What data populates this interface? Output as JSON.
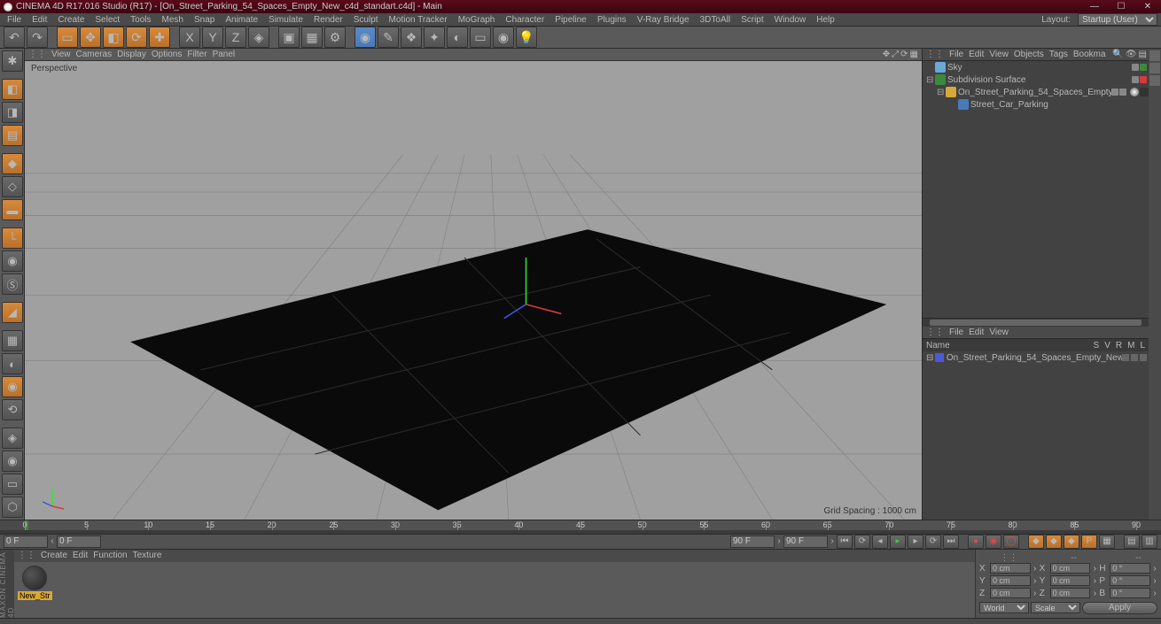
{
  "titlebar": {
    "title": "CINEMA 4D R17.016 Studio (R17) - [On_Street_Parking_54_Spaces_Empty_New_c4d_standart.c4d] - Main"
  },
  "menubar": {
    "items": [
      "File",
      "Edit",
      "Create",
      "Select",
      "Tools",
      "Mesh",
      "Snap",
      "Animate",
      "Simulate",
      "Render",
      "Sculpt",
      "Motion Tracker",
      "MoGraph",
      "Character",
      "Pipeline",
      "Plugins",
      "V-Ray Bridge",
      "3DToAll",
      "Script",
      "Window",
      "Help"
    ],
    "layout_label": "Layout:",
    "layout_value": "Startup (User)"
  },
  "viewport_menubar": {
    "items": [
      "View",
      "Cameras",
      "Display",
      "Options",
      "Filter",
      "Panel"
    ]
  },
  "viewport": {
    "label": "Perspective",
    "grid_spacing": "Grid Spacing : 1000 cm"
  },
  "objects_panel": {
    "menu": [
      "File",
      "Edit",
      "View",
      "Objects",
      "Tags",
      "Bookma"
    ],
    "tree": [
      {
        "depth": 0,
        "icon": "#6aa8d8",
        "label": "Sky",
        "dots": [
          "#888",
          "#3a8a3a"
        ]
      },
      {
        "depth": 0,
        "icon": "#3a8a3a",
        "label": "Subdivision Surface",
        "dots": [
          "#888",
          "#d83a3a"
        ],
        "exp": "⊟"
      },
      {
        "depth": 1,
        "icon": "#d8a838",
        "label": "On_Street_Parking_54_Spaces_Empty_New",
        "dots": [
          "#888",
          "#888"
        ],
        "tags": true,
        "exp": "⊟"
      },
      {
        "depth": 2,
        "icon": "#4a7ab8",
        "label": "Street_Car_Parking",
        "dots": []
      }
    ]
  },
  "takes_panel": {
    "menu": [
      "File",
      "Edit",
      "View"
    ],
    "header": {
      "name": "Name",
      "cols": [
        "S",
        "V",
        "R",
        "M",
        "L"
      ]
    },
    "row": {
      "icon": "#4a5ad8",
      "label": "On_Street_Parking_54_Spaces_Empty_New"
    }
  },
  "timeline": {
    "ticks": [
      0,
      5,
      10,
      15,
      20,
      25,
      30,
      35,
      40,
      45,
      50,
      55,
      60,
      65,
      70,
      75,
      80,
      85,
      90
    ],
    "start_field": "0 F",
    "cur_start": "0 F",
    "cur_end": "90 F",
    "end_field": "90 F"
  },
  "material_panel": {
    "menu": [
      "Create",
      "Edit",
      "Function",
      "Texture"
    ],
    "swatch_label": "New_Str"
  },
  "coords": {
    "headers": [
      "",
      "",
      ""
    ],
    "rows": [
      {
        "axis": "X",
        "pos": "0 cm",
        "scale_lbl": "X",
        "size": "0 cm",
        "rot_lbl": "H",
        "rot": "0 °"
      },
      {
        "axis": "Y",
        "pos": "0 cm",
        "scale_lbl": "Y",
        "size": "0 cm",
        "rot_lbl": "P",
        "rot": "0 °"
      },
      {
        "axis": "Z",
        "pos": "0 cm",
        "scale_lbl": "Z",
        "size": "0 cm",
        "rot_lbl": "B",
        "rot": "0 °"
      }
    ],
    "world": "World",
    "scale": "Scale",
    "apply": "Apply"
  },
  "brand": "MAXON   CINEMA 4D"
}
